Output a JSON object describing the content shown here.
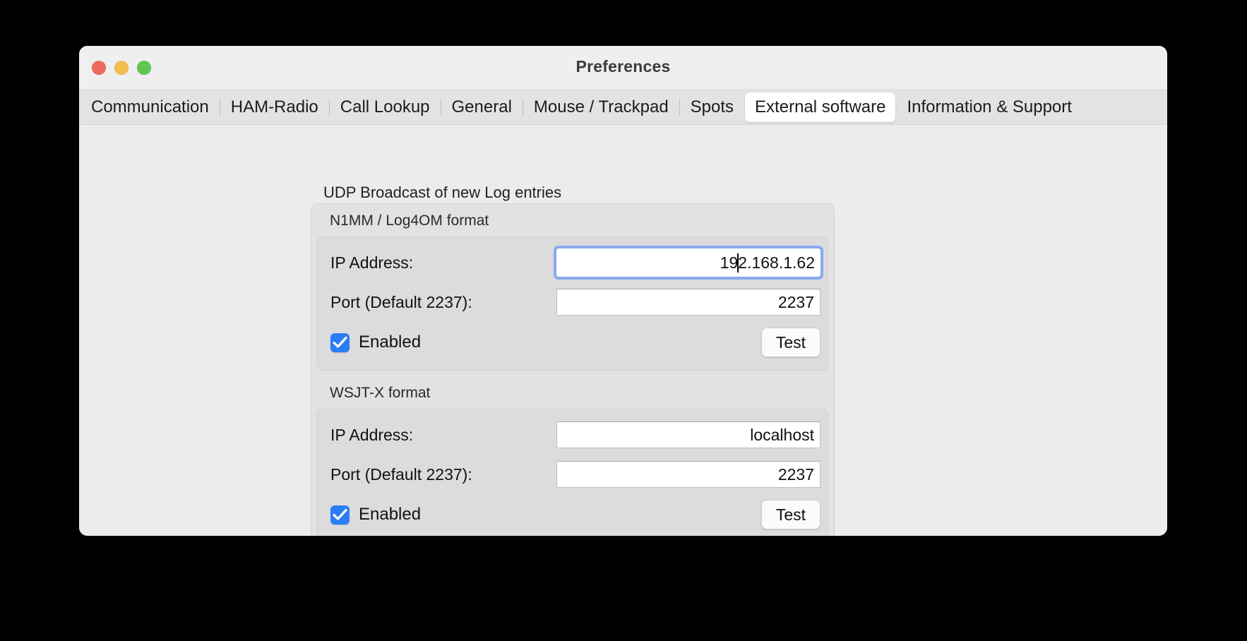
{
  "window": {
    "title": "Preferences",
    "traffic_lights": [
      {
        "name": "close",
        "color": "#EC6A5E"
      },
      {
        "name": "minimize",
        "color": "#F4BD4F"
      },
      {
        "name": "zoom",
        "color": "#61C554"
      }
    ]
  },
  "tabs": [
    {
      "label": "Communication",
      "selected": false
    },
    {
      "label": "HAM-Radio",
      "selected": false
    },
    {
      "label": "Call Lookup",
      "selected": false
    },
    {
      "label": "General",
      "selected": false
    },
    {
      "label": "Mouse / Trackpad",
      "selected": false
    },
    {
      "label": "Spots",
      "selected": false
    },
    {
      "label": "External software",
      "selected": true
    },
    {
      "label": "Information & Support",
      "selected": false
    }
  ],
  "main": {
    "section_title": "UDP Broadcast of new Log entries",
    "groups": [
      {
        "label": "N1MM / Log4OM format",
        "ip_label": "IP Address:",
        "ip_value_before_caret": "19",
        "ip_value_after_caret": "2.168.1.62",
        "ip_value": "192.168.1.62",
        "ip_focused": true,
        "port_label": "Port (Default 2237):",
        "port_value": "2237",
        "enabled_label": "Enabled",
        "enabled_checked": true,
        "test_label": "Test"
      },
      {
        "label": "WSJT-X format",
        "ip_label": "IP Address:",
        "ip_value": "localhost",
        "ip_focused": false,
        "port_label": "Port (Default 2237):",
        "port_value": "2237",
        "enabled_label": "Enabled",
        "enabled_checked": true,
        "test_label": "Test"
      }
    ]
  },
  "colors": {
    "accent": "#2B7DF6",
    "focus_ring": "#8AA9EE",
    "window_bg": "#ECECEC",
    "tabbar_bg": "#E3E3E3"
  }
}
